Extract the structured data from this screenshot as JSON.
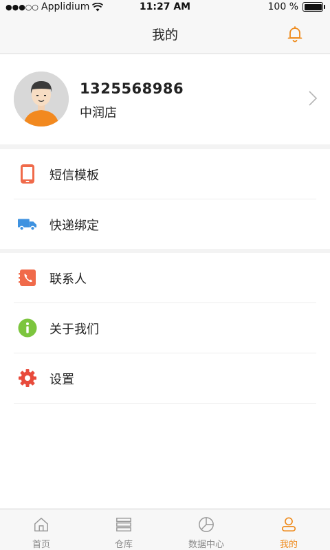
{
  "status_bar": {
    "carrier": "Applidium",
    "signal": "●●●○○",
    "time": "11:27 AM",
    "battery": "100 %"
  },
  "nav": {
    "title": "我的",
    "bell_icon": "bell-icon"
  },
  "profile": {
    "phone": "1325568986",
    "store": "中润店"
  },
  "menu_group_1": [
    {
      "label": "短信模板",
      "icon": "phone-icon"
    },
    {
      "label": "快递绑定",
      "icon": "truck-icon"
    }
  ],
  "menu_group_2": [
    {
      "label": "联系人",
      "icon": "contacts-icon"
    },
    {
      "label": "关于我们",
      "icon": "info-icon"
    },
    {
      "label": "设置",
      "icon": "gear-icon"
    }
  ],
  "tabs": [
    {
      "label": "首页",
      "icon": "home-icon"
    },
    {
      "label": "仓库",
      "icon": "warehouse-icon"
    },
    {
      "label": "数据中心",
      "icon": "pie-chart-icon"
    },
    {
      "label": "我的",
      "icon": "user-icon",
      "active": true
    }
  ],
  "colors": {
    "accent": "#ee8a1b",
    "sms": "#f06a4a",
    "express": "#3e92e0",
    "contacts": "#f06a4a",
    "info": "#7cc53e",
    "settings": "#e84b3c"
  }
}
